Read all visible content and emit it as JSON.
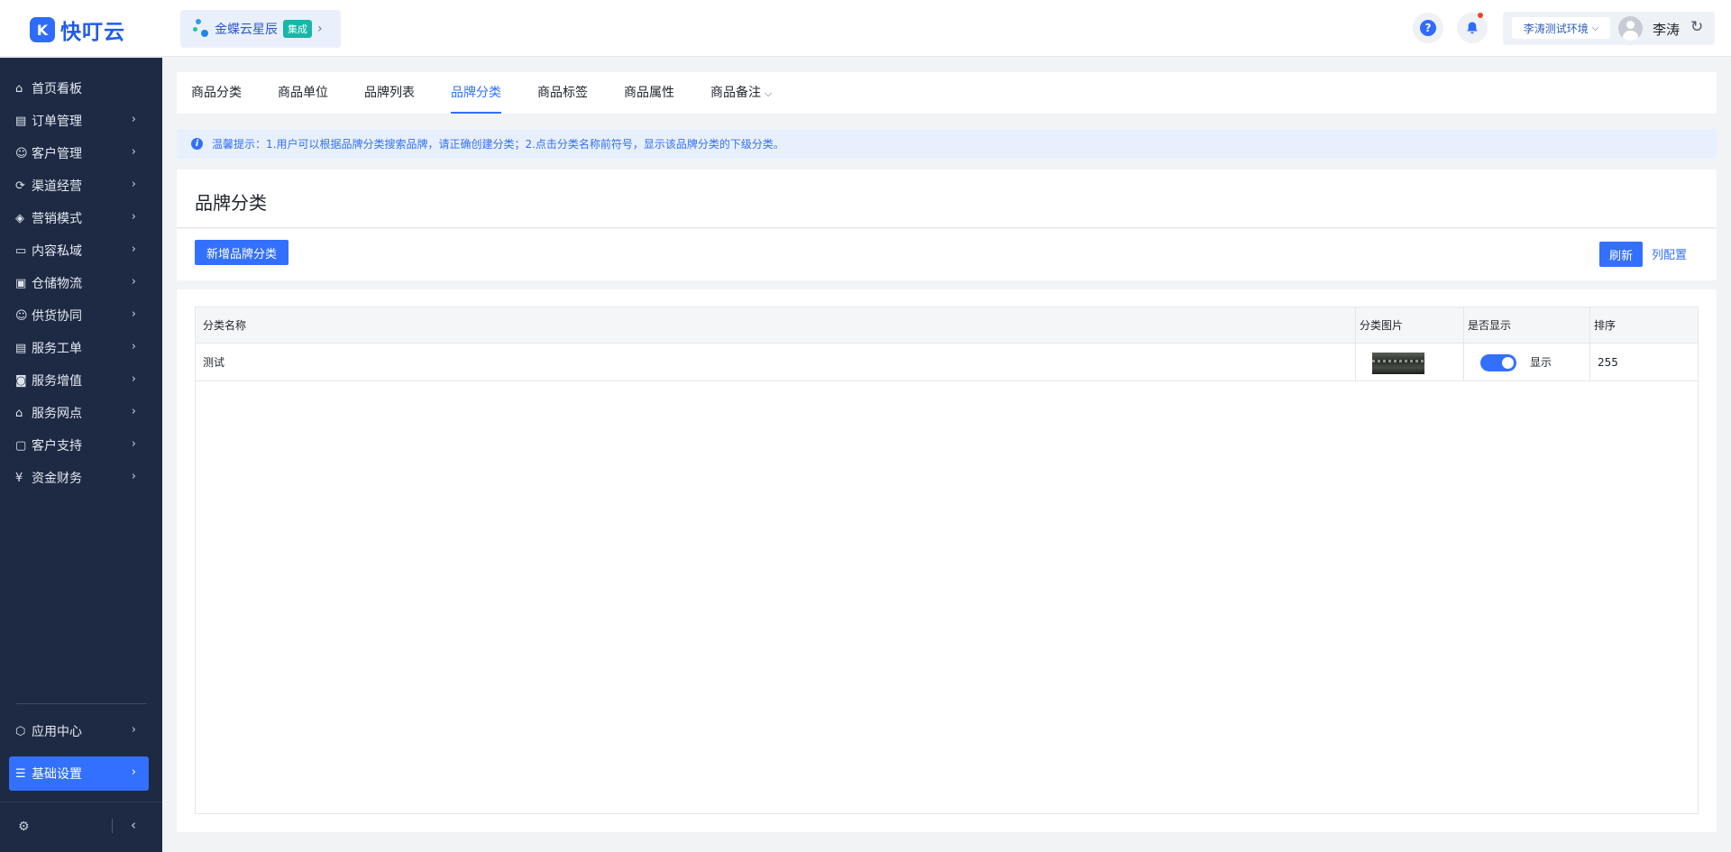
{
  "brand": {
    "logo_glyph": "K",
    "name": "快叮云"
  },
  "integration": {
    "name": "金蝶云星辰",
    "badge": "集成"
  },
  "header": {
    "help_glyph": "?",
    "env": "李涛测试环境",
    "user": "李涛"
  },
  "sidebar": {
    "items": [
      {
        "label": "首页看板",
        "icon": "home-icon",
        "has_children": false
      },
      {
        "label": "订单管理",
        "icon": "order-icon",
        "has_children": true
      },
      {
        "label": "客户管理",
        "icon": "user-icon",
        "has_children": true
      },
      {
        "label": "渠道经营",
        "icon": "channel-icon",
        "has_children": true
      },
      {
        "label": "营销模式",
        "icon": "tag-icon",
        "has_children": true
      },
      {
        "label": "内容私域",
        "icon": "image-icon",
        "has_children": true
      },
      {
        "label": "仓储物流",
        "icon": "warehouse-icon",
        "has_children": true
      },
      {
        "label": "供货协同",
        "icon": "supply-icon",
        "has_children": true
      },
      {
        "label": "服务工单",
        "icon": "ticket-icon",
        "has_children": true
      },
      {
        "label": "服务增值",
        "icon": "bag-icon",
        "has_children": true
      },
      {
        "label": "服务网点",
        "icon": "store-icon",
        "has_children": true
      },
      {
        "label": "客户支持",
        "icon": "support-icon",
        "has_children": true
      },
      {
        "label": "资金财务",
        "icon": "yuan-icon",
        "has_children": true
      }
    ],
    "bottom_items": [
      {
        "label": "应用中心",
        "icon": "cube-icon"
      },
      {
        "label": "基础设置",
        "icon": "settings-sliders-icon",
        "active": true
      }
    ]
  },
  "tabs": [
    {
      "label": "商品分类",
      "active": false
    },
    {
      "label": "商品单位",
      "active": false
    },
    {
      "label": "品牌列表",
      "active": false
    },
    {
      "label": "品牌分类",
      "active": true
    },
    {
      "label": "商品标签",
      "active": false
    },
    {
      "label": "商品属性",
      "active": false
    },
    {
      "label": "商品备注",
      "active": false,
      "dropdown": true
    }
  ],
  "notice": "温馨提示：1.用户可以根据品牌分类搜索品牌，请正确创建分类；2.点击分类名称前符号，显示该品牌分类的下级分类。",
  "page": {
    "title": "品牌分类"
  },
  "toolbar": {
    "add_label": "新增品牌分类",
    "refresh_label": "刷新",
    "columns_label": "列配置"
  },
  "table": {
    "columns": [
      "分类名称",
      "分类图片",
      "是否显示",
      "排序"
    ],
    "rows": [
      {
        "name": "测试",
        "has_image": true,
        "visible": true,
        "visible_label": "显示",
        "sort": "255"
      }
    ]
  },
  "colors": {
    "primary": "#3370ff",
    "sidebar_bg": "#1e2a44",
    "notice_bg": "#e8f0fe",
    "integration_badge": "#16b7a8"
  }
}
